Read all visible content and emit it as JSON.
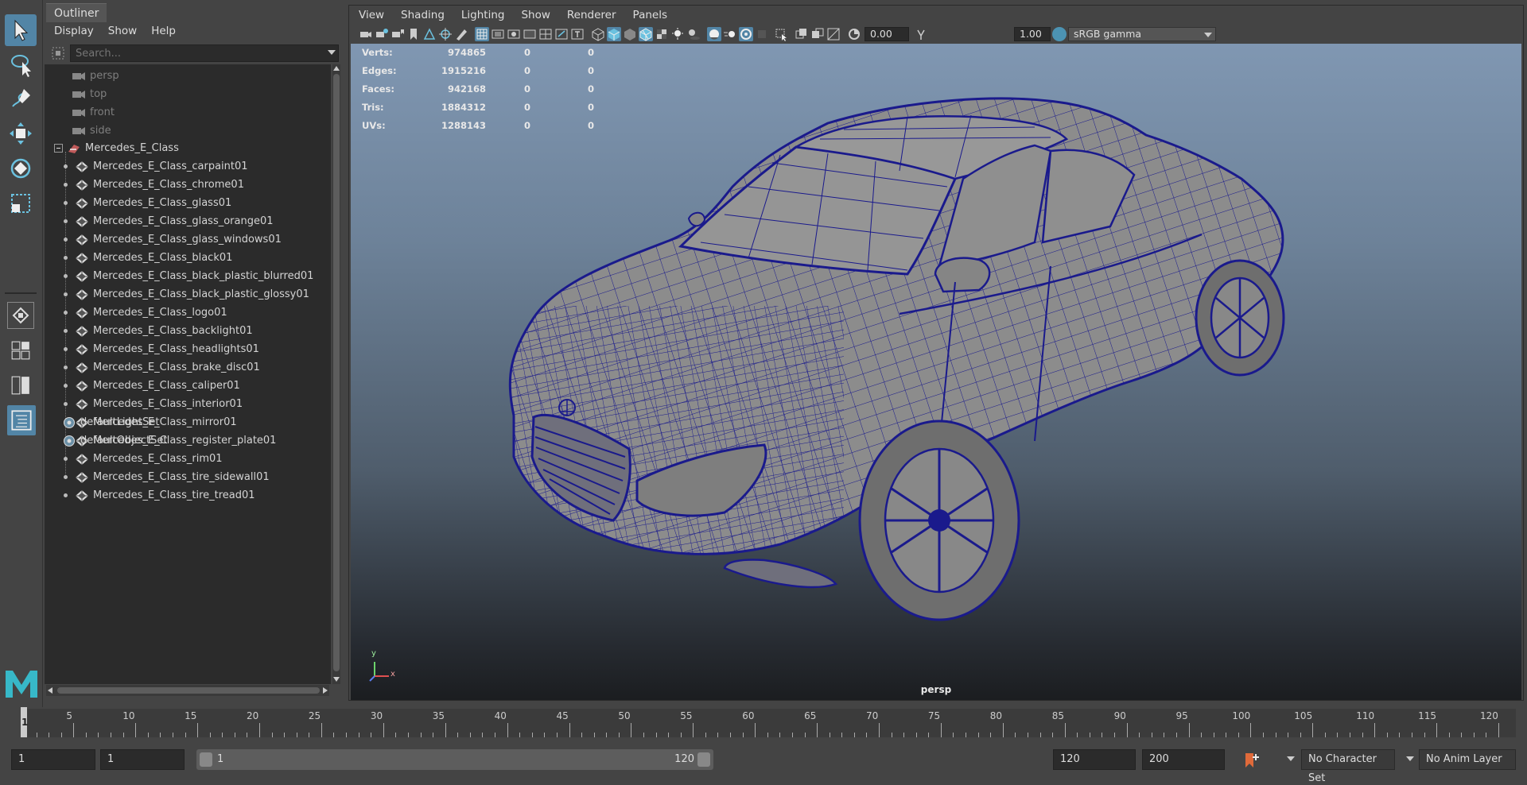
{
  "toolbox": {
    "tools": [
      {
        "name": "select-tool-icon",
        "active": true
      },
      {
        "name": "lasso-tool-icon",
        "active": false
      },
      {
        "name": "paint-select-tool-icon",
        "active": false
      },
      {
        "name": "move-tool-icon",
        "active": false
      },
      {
        "name": "rotate-tool-icon",
        "active": false
      },
      {
        "name": "scale-tool-icon",
        "active": false
      }
    ],
    "logo_letter": "M"
  },
  "outliner": {
    "tab_label": "Outliner",
    "menu": [
      "Display",
      "Show",
      "Help"
    ],
    "search_placeholder": "Search...",
    "cameras": [
      "persp",
      "top",
      "front",
      "side"
    ],
    "group_name": "Mercedes_E_Class",
    "children": [
      "Mercedes_E_Class_carpaint01",
      "Mercedes_E_Class_chrome01",
      "Mercedes_E_Class_glass01",
      "Mercedes_E_Class_glass_orange01",
      "Mercedes_E_Class_glass_windows01",
      "Mercedes_E_Class_black01",
      "Mercedes_E_Class_black_plastic_blurred01",
      "Mercedes_E_Class_black_plastic_glossy01",
      "Mercedes_E_Class_logo01",
      "Mercedes_E_Class_backlight01",
      "Mercedes_E_Class_headlights01",
      "Mercedes_E_Class_brake_disc01",
      "Mercedes_E_Class_caliper01",
      "Mercedes_E_Class_interior01",
      "Mercedes_E_Class_mirror01",
      "Mercedes_E_Class_register_plate01",
      "Mercedes_E_Class_rim01",
      "Mercedes_E_Class_tire_sidewall01",
      "Mercedes_E_Class_tire_tread01"
    ],
    "sets": [
      "defaultLightSet",
      "defaultObjectSet"
    ]
  },
  "viewport": {
    "menu": [
      "View",
      "Shading",
      "Lighting",
      "Show",
      "Renderer",
      "Panels"
    ],
    "exposure_value": "0.00",
    "gamma_value": "1.00",
    "color_space": "sRGB gamma",
    "hud": [
      {
        "label": "Verts:",
        "v1": "974865",
        "v2": "0",
        "v3": "0"
      },
      {
        "label": "Edges:",
        "v1": "1915216",
        "v2": "0",
        "v3": "0"
      },
      {
        "label": "Faces:",
        "v1": "942168",
        "v2": "0",
        "v3": "0"
      },
      {
        "label": "Tris:",
        "v1": "1884312",
        "v2": "0",
        "v3": "0"
      },
      {
        "label": "UVs:",
        "v1": "1288143",
        "v2": "0",
        "v3": "0"
      }
    ],
    "camera_name": "persp",
    "axis_y": "y",
    "axis_x": "x",
    "wire_color": "#1a1a8c",
    "car_fill": "#8c8c8c"
  },
  "timeline": {
    "current_frame": "1",
    "ticks": [
      "5",
      "10",
      "15",
      "20",
      "25",
      "30",
      "35",
      "40",
      "45",
      "50",
      "55",
      "60",
      "65",
      "70",
      "75",
      "80",
      "85",
      "90",
      "95",
      "100",
      "105",
      "110",
      "115",
      "120"
    ]
  },
  "range_bar": {
    "start_field": "1",
    "playback_start": "1",
    "slider_start": "1",
    "slider_end": "120",
    "playback_end": "120",
    "end_field": "200",
    "character_set": "No Character Set",
    "anim_layer": "No Anim Layer"
  }
}
